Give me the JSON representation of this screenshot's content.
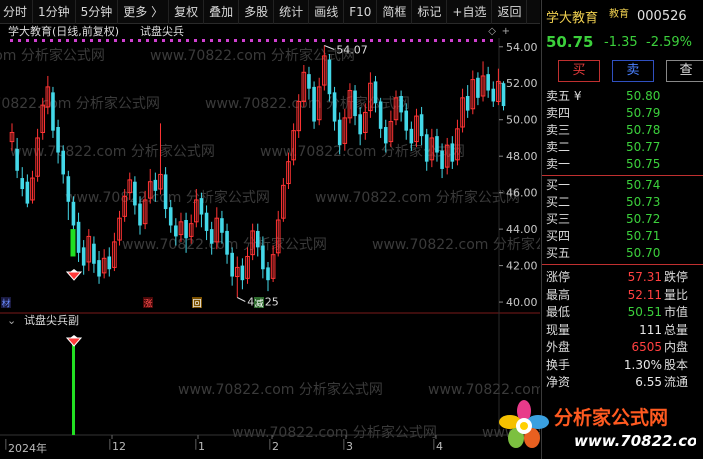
{
  "toolbar": {
    "items": [
      "分时",
      "1分钟",
      "5分钟",
      "更多 〉",
      "复权",
      "叠加",
      "多股",
      "统计",
      "画线",
      "F10",
      "简框",
      "标记",
      "+自选",
      "返回"
    ]
  },
  "chart": {
    "stock_title": "学大教育(日线,前复权)",
    "indicator_name": "试盘尖兵",
    "sub_indicator_name": "试盘尖兵副",
    "y_ticks": [
      "54.00",
      "52.00",
      "50.00",
      "48.00",
      "46.00",
      "44.00",
      "42.00",
      "40.00"
    ],
    "high_label": "54.07",
    "low_label": "40.25",
    "markers": {
      "zhang": "涨",
      "hui": "回",
      "jian": "减",
      "cai": "材"
    },
    "watermark": "www.70822.com 分析家公式网",
    "date_labels": [
      "2024年",
      "12",
      "1",
      "2",
      "3",
      "4"
    ]
  },
  "panel": {
    "name": "学大教育",
    "tag": "教育",
    "code": "000526",
    "last": "50.75",
    "change": "-1.35",
    "change_pct": "-2.59%",
    "buy_btn": "买",
    "sell_btn": "卖",
    "check_btn": "查",
    "asks": [
      {
        "label": "卖五 ¥",
        "price": "50.80"
      },
      {
        "label": "卖四",
        "price": "50.79"
      },
      {
        "label": "卖三",
        "price": "50.78"
      },
      {
        "label": "卖二",
        "price": "50.77"
      },
      {
        "label": "卖一",
        "price": "50.75"
      }
    ],
    "bids": [
      {
        "label": "买一",
        "price": "50.74"
      },
      {
        "label": "买二",
        "price": "50.73"
      },
      {
        "label": "买三",
        "price": "50.72"
      },
      {
        "label": "买四",
        "price": "50.71"
      },
      {
        "label": "买五",
        "price": "50.70"
      }
    ],
    "stats": [
      {
        "label": "涨停",
        "value": "57.31",
        "right": "跌停",
        "cls": "red"
      },
      {
        "label": "最高",
        "value": "52.11",
        "right": "量比",
        "cls": "red"
      },
      {
        "label": "最低",
        "value": "50.51",
        "right": "市值",
        "cls": "grn"
      },
      {
        "label": "现量",
        "value": "111",
        "right": "总量",
        "cls": "wht"
      },
      {
        "label": "外盘",
        "value": "6505",
        "right": "内盘",
        "cls": "red"
      },
      {
        "label": "换手",
        "value": "1.30%",
        "right": "股本",
        "cls": "wht"
      },
      {
        "label": "净资",
        "value": "6.55",
        "right": "流通",
        "cls": "wht"
      }
    ],
    "logo_text": "分析家公式网",
    "logo_url": "www.70822.com"
  }
}
